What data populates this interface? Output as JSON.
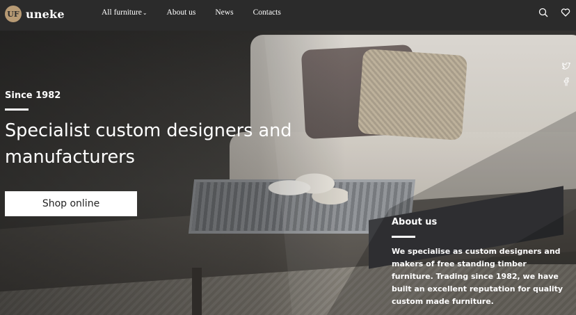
{
  "brand": {
    "mark": "UF",
    "name": "uneke"
  },
  "nav": {
    "items": [
      {
        "label": "All furniture",
        "has_caret": true
      },
      {
        "label": "About us"
      },
      {
        "label": "News"
      },
      {
        "label": "Contacts"
      }
    ],
    "caret": "⌄"
  },
  "icons": {
    "search": "search-icon",
    "wishlist": "heart-icon",
    "twitter": "twitter-icon",
    "facebook": "facebook-icon"
  },
  "hero": {
    "since": "Since 1982",
    "headline": "Specialist custom designers and manufacturers",
    "cta": "Shop online"
  },
  "about": {
    "title": "About us",
    "text": "We specialise as custom designers and makers of free standing timber furniture. Trading since 1982, we have built an excellent reputation for quality custom made furniture."
  },
  "colors": {
    "navbar": "#2b2b2b",
    "accent_logo": "#b79a74",
    "text": "#ffffff"
  }
}
